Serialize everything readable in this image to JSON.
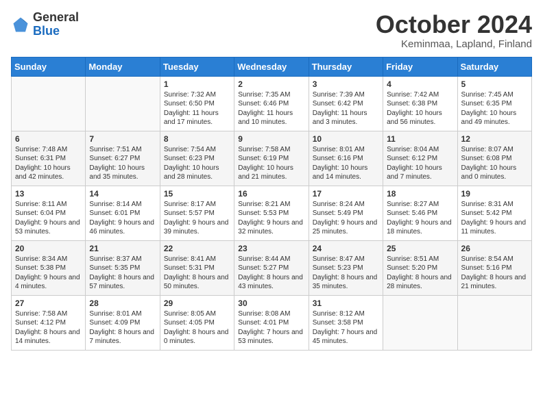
{
  "header": {
    "logo_general": "General",
    "logo_blue": "Blue",
    "month_title": "October 2024",
    "subtitle": "Keminmaa, Lapland, Finland"
  },
  "weekdays": [
    "Sunday",
    "Monday",
    "Tuesday",
    "Wednesday",
    "Thursday",
    "Friday",
    "Saturday"
  ],
  "weeks": [
    [
      {
        "day": "",
        "sunrise": "",
        "sunset": "",
        "daylight": ""
      },
      {
        "day": "",
        "sunrise": "",
        "sunset": "",
        "daylight": ""
      },
      {
        "day": "1",
        "sunrise": "Sunrise: 7:32 AM",
        "sunset": "Sunset: 6:50 PM",
        "daylight": "Daylight: 11 hours and 17 minutes."
      },
      {
        "day": "2",
        "sunrise": "Sunrise: 7:35 AM",
        "sunset": "Sunset: 6:46 PM",
        "daylight": "Daylight: 11 hours and 10 minutes."
      },
      {
        "day": "3",
        "sunrise": "Sunrise: 7:39 AM",
        "sunset": "Sunset: 6:42 PM",
        "daylight": "Daylight: 11 hours and 3 minutes."
      },
      {
        "day": "4",
        "sunrise": "Sunrise: 7:42 AM",
        "sunset": "Sunset: 6:38 PM",
        "daylight": "Daylight: 10 hours and 56 minutes."
      },
      {
        "day": "5",
        "sunrise": "Sunrise: 7:45 AM",
        "sunset": "Sunset: 6:35 PM",
        "daylight": "Daylight: 10 hours and 49 minutes."
      }
    ],
    [
      {
        "day": "6",
        "sunrise": "Sunrise: 7:48 AM",
        "sunset": "Sunset: 6:31 PM",
        "daylight": "Daylight: 10 hours and 42 minutes."
      },
      {
        "day": "7",
        "sunrise": "Sunrise: 7:51 AM",
        "sunset": "Sunset: 6:27 PM",
        "daylight": "Daylight: 10 hours and 35 minutes."
      },
      {
        "day": "8",
        "sunrise": "Sunrise: 7:54 AM",
        "sunset": "Sunset: 6:23 PM",
        "daylight": "Daylight: 10 hours and 28 minutes."
      },
      {
        "day": "9",
        "sunrise": "Sunrise: 7:58 AM",
        "sunset": "Sunset: 6:19 PM",
        "daylight": "Daylight: 10 hours and 21 minutes."
      },
      {
        "day": "10",
        "sunrise": "Sunrise: 8:01 AM",
        "sunset": "Sunset: 6:16 PM",
        "daylight": "Daylight: 10 hours and 14 minutes."
      },
      {
        "day": "11",
        "sunrise": "Sunrise: 8:04 AM",
        "sunset": "Sunset: 6:12 PM",
        "daylight": "Daylight: 10 hours and 7 minutes."
      },
      {
        "day": "12",
        "sunrise": "Sunrise: 8:07 AM",
        "sunset": "Sunset: 6:08 PM",
        "daylight": "Daylight: 10 hours and 0 minutes."
      }
    ],
    [
      {
        "day": "13",
        "sunrise": "Sunrise: 8:11 AM",
        "sunset": "Sunset: 6:04 PM",
        "daylight": "Daylight: 9 hours and 53 minutes."
      },
      {
        "day": "14",
        "sunrise": "Sunrise: 8:14 AM",
        "sunset": "Sunset: 6:01 PM",
        "daylight": "Daylight: 9 hours and 46 minutes."
      },
      {
        "day": "15",
        "sunrise": "Sunrise: 8:17 AM",
        "sunset": "Sunset: 5:57 PM",
        "daylight": "Daylight: 9 hours and 39 minutes."
      },
      {
        "day": "16",
        "sunrise": "Sunrise: 8:21 AM",
        "sunset": "Sunset: 5:53 PM",
        "daylight": "Daylight: 9 hours and 32 minutes."
      },
      {
        "day": "17",
        "sunrise": "Sunrise: 8:24 AM",
        "sunset": "Sunset: 5:49 PM",
        "daylight": "Daylight: 9 hours and 25 minutes."
      },
      {
        "day": "18",
        "sunrise": "Sunrise: 8:27 AM",
        "sunset": "Sunset: 5:46 PM",
        "daylight": "Daylight: 9 hours and 18 minutes."
      },
      {
        "day": "19",
        "sunrise": "Sunrise: 8:31 AM",
        "sunset": "Sunset: 5:42 PM",
        "daylight": "Daylight: 9 hours and 11 minutes."
      }
    ],
    [
      {
        "day": "20",
        "sunrise": "Sunrise: 8:34 AM",
        "sunset": "Sunset: 5:38 PM",
        "daylight": "Daylight: 9 hours and 4 minutes."
      },
      {
        "day": "21",
        "sunrise": "Sunrise: 8:37 AM",
        "sunset": "Sunset: 5:35 PM",
        "daylight": "Daylight: 8 hours and 57 minutes."
      },
      {
        "day": "22",
        "sunrise": "Sunrise: 8:41 AM",
        "sunset": "Sunset: 5:31 PM",
        "daylight": "Daylight: 8 hours and 50 minutes."
      },
      {
        "day": "23",
        "sunrise": "Sunrise: 8:44 AM",
        "sunset": "Sunset: 5:27 PM",
        "daylight": "Daylight: 8 hours and 43 minutes."
      },
      {
        "day": "24",
        "sunrise": "Sunrise: 8:47 AM",
        "sunset": "Sunset: 5:23 PM",
        "daylight": "Daylight: 8 hours and 35 minutes."
      },
      {
        "day": "25",
        "sunrise": "Sunrise: 8:51 AM",
        "sunset": "Sunset: 5:20 PM",
        "daylight": "Daylight: 8 hours and 28 minutes."
      },
      {
        "day": "26",
        "sunrise": "Sunrise: 8:54 AM",
        "sunset": "Sunset: 5:16 PM",
        "daylight": "Daylight: 8 hours and 21 minutes."
      }
    ],
    [
      {
        "day": "27",
        "sunrise": "Sunrise: 7:58 AM",
        "sunset": "Sunset: 4:12 PM",
        "daylight": "Daylight: 8 hours and 14 minutes."
      },
      {
        "day": "28",
        "sunrise": "Sunrise: 8:01 AM",
        "sunset": "Sunset: 4:09 PM",
        "daylight": "Daylight: 8 hours and 7 minutes."
      },
      {
        "day": "29",
        "sunrise": "Sunrise: 8:05 AM",
        "sunset": "Sunset: 4:05 PM",
        "daylight": "Daylight: 8 hours and 0 minutes."
      },
      {
        "day": "30",
        "sunrise": "Sunrise: 8:08 AM",
        "sunset": "Sunset: 4:01 PM",
        "daylight": "Daylight: 7 hours and 53 minutes."
      },
      {
        "day": "31",
        "sunrise": "Sunrise: 8:12 AM",
        "sunset": "Sunset: 3:58 PM",
        "daylight": "Daylight: 7 hours and 45 minutes."
      },
      {
        "day": "",
        "sunrise": "",
        "sunset": "",
        "daylight": ""
      },
      {
        "day": "",
        "sunrise": "",
        "sunset": "",
        "daylight": ""
      }
    ]
  ]
}
